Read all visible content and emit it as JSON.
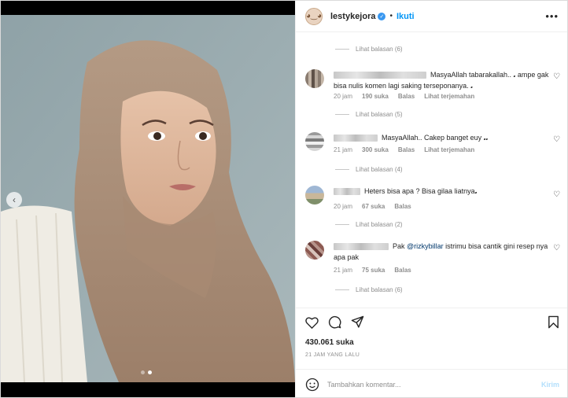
{
  "header": {
    "username": "lestykejora",
    "separator": "•",
    "follow_label": "Ikuti",
    "more_label": "•••"
  },
  "carousel": {
    "prev_label": "‹",
    "dot_count": 2,
    "active_dot": 2
  },
  "comments": [
    {
      "replies_before": "Lihat balasan (6)",
      "text": "MasyaAllah tabarakallah.. 𝅘 ampe gak bisa nulis komen lagi saking terseponanya. 𝅘",
      "time": "20 jam",
      "likes": "190 suka",
      "reply": "Balas",
      "translate": "Lihat terjemahan",
      "replies_after": "Lihat balasan (5)"
    },
    {
      "text": "MasyaAllah.. Cakep banget euy 𝅘𝅘",
      "time": "21 jam",
      "likes": "300 suka",
      "reply": "Balas",
      "translate": "Lihat terjemahan",
      "replies_after": "Lihat balasan (4)"
    },
    {
      "text": "Heters bisa apa ? Bisa gilaa liatnya𝅘",
      "time": "20 jam",
      "likes": "67 suka",
      "reply": "Balas",
      "replies_after": "Lihat balasan (2)"
    },
    {
      "text_prefix": "Pak ",
      "mention": "@rizkybillar",
      "text_suffix": " istrimu bisa cantik gini resep nya apa pak",
      "time": "21 jam",
      "likes": "75 suka",
      "reply": "Balas",
      "replies_after": "Lihat balasan (6)"
    }
  ],
  "post": {
    "likes": "430.061 suka",
    "time": "21 JAM YANG LALU"
  },
  "add_comment": {
    "placeholder": "Tambahkan komentar...",
    "post_label": "Kirim"
  },
  "icons": [
    "verified-badge-icon",
    "heart-icon",
    "comment-icon",
    "share-icon",
    "bookmark-icon",
    "emoji-icon"
  ],
  "colors": {
    "accent": "#0095f6",
    "mention": "#00376b",
    "muted": "#8e8e8e",
    "post_disabled": "#b2dffc"
  }
}
